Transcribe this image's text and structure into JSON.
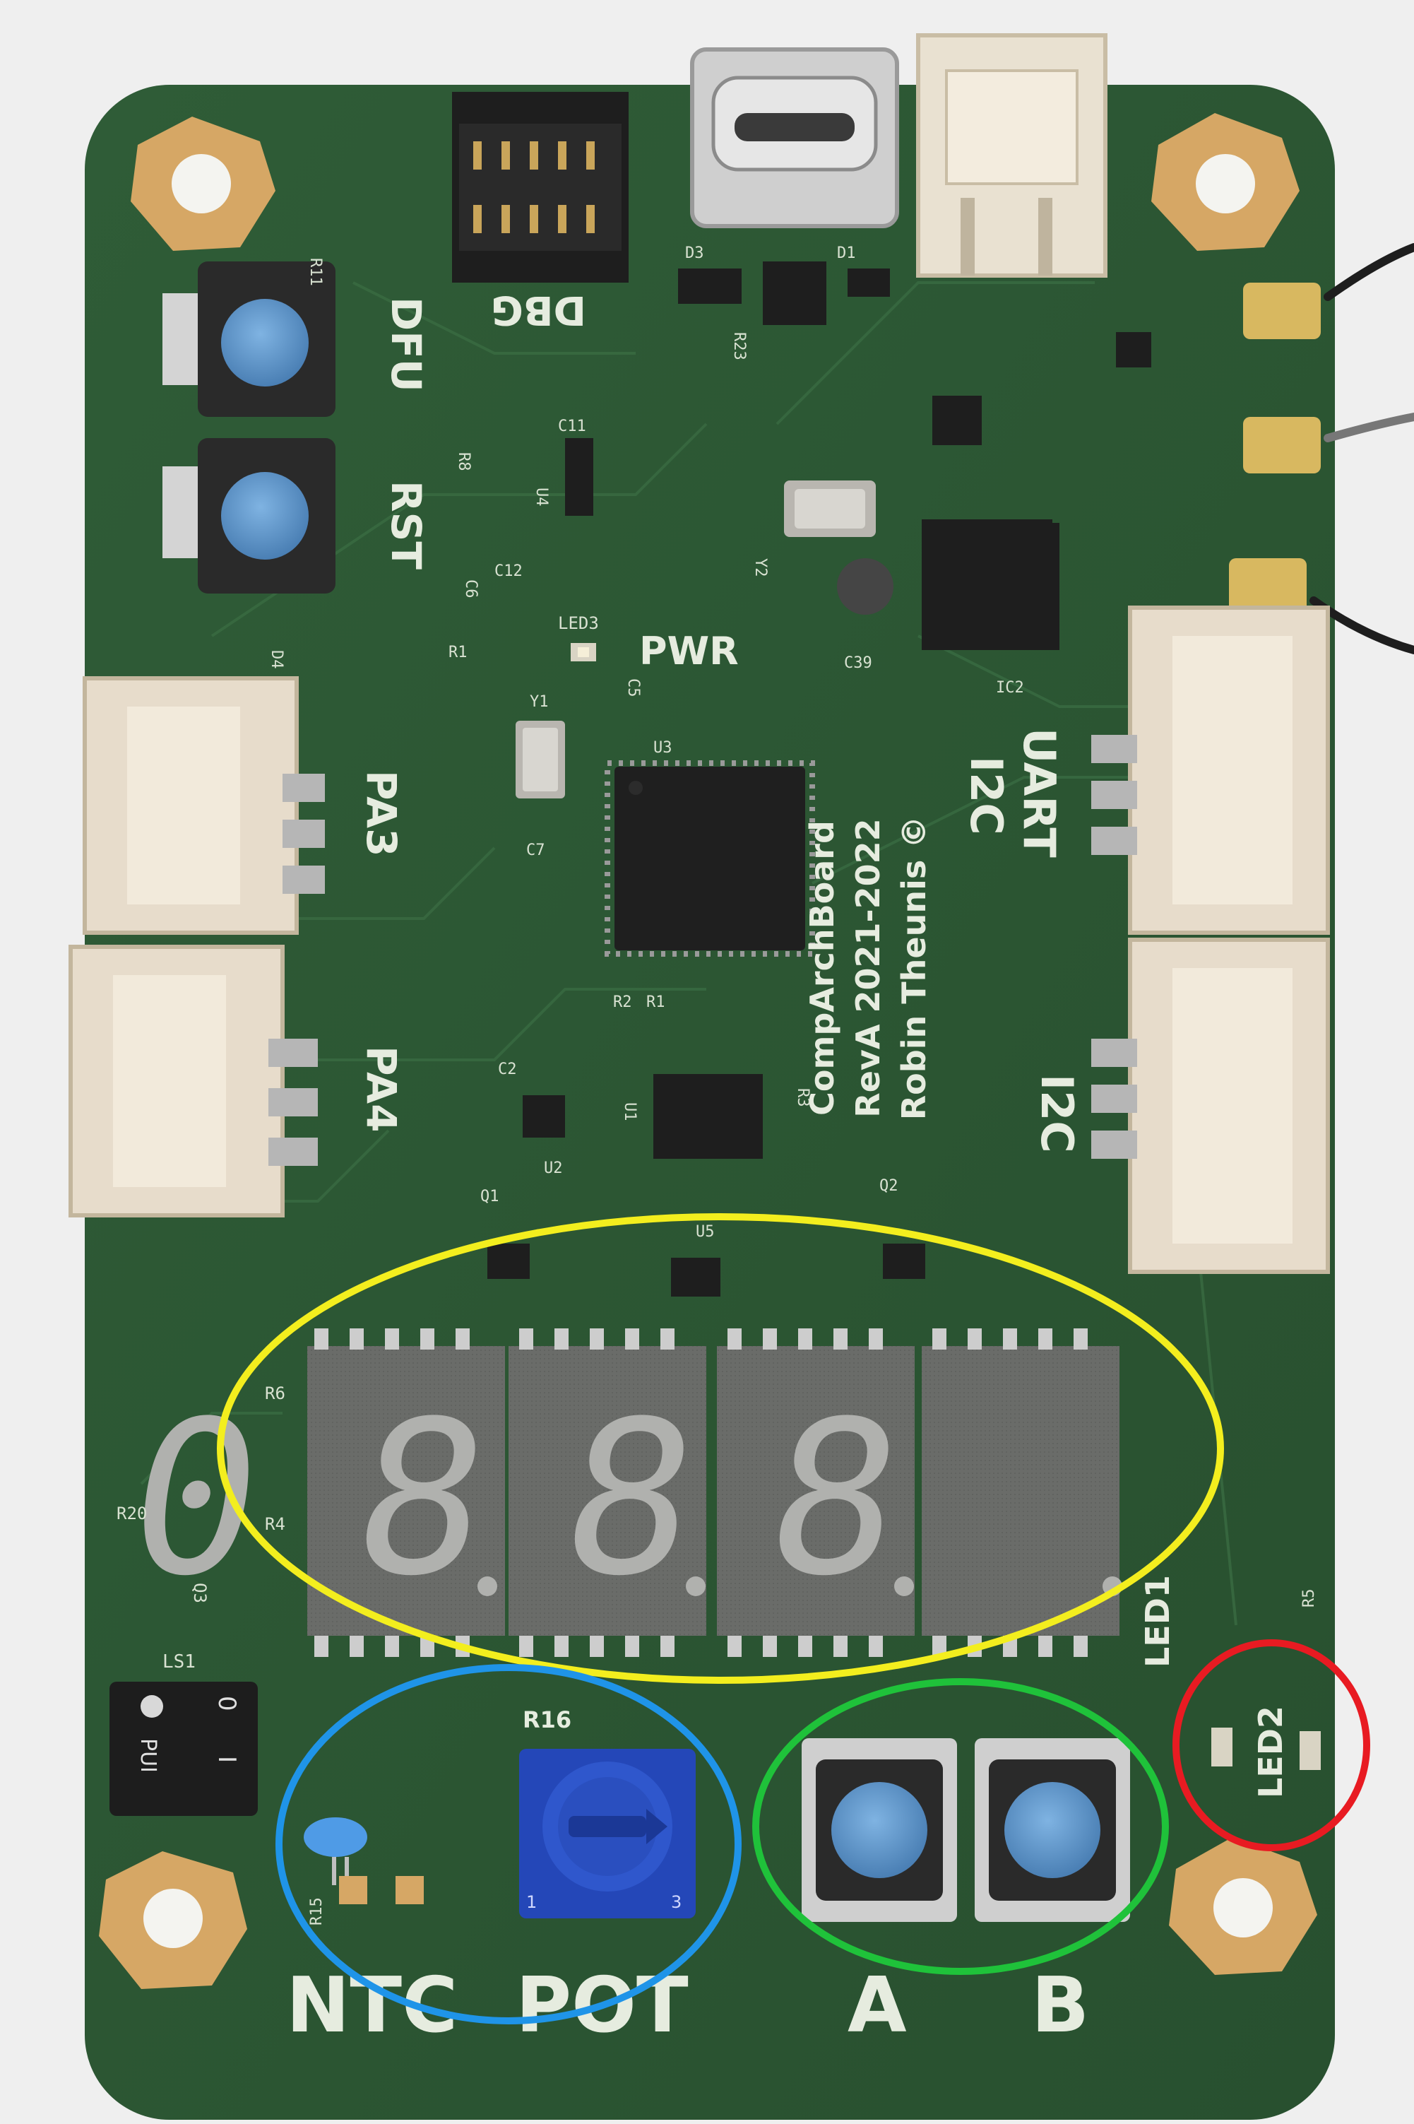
{
  "board": {
    "colors": {
      "pcb": "#2f5a37",
      "pcb_dark": "#23462b",
      "silkscreen": "#e6ecdf",
      "connector": "#e7dccb",
      "button_cap": "#5b94c8",
      "potentiometer": "#2447b8",
      "seven_seg_body": "#6b6d6a",
      "highlight_yellow": "#f3ee1e",
      "highlight_blue": "#1f94e8",
      "highlight_green": "#1fc23a",
      "highlight_red": "#e81b22"
    },
    "labels": {
      "dbg": "DBG",
      "dfu": "DFU",
      "rst": "RST",
      "pwr": "PWR",
      "led3": "LED3",
      "pa3": "PA3",
      "pa4": "PA4",
      "i2c_upper": "I2C",
      "uart": "UART",
      "i2c_lower": "I2C",
      "ntc": "NTC",
      "pot": "POT",
      "button_a": "A",
      "button_b": "B",
      "led1": "LED1",
      "led2": "LED2",
      "buzzer_on": "0",
      "buzzer_off": "I",
      "buzzer_brand": "PUI",
      "board_line1": "CompArchBoard",
      "board_line2": "RevA 2021-2022",
      "board_line3": "Robin Theunis ©",
      "refs": {
        "r11": "R11",
        "r8": "R8",
        "c11": "C11",
        "u4": "U4",
        "c12": "C12",
        "c6": "C6",
        "r1_top": "R1",
        "d3": "D3",
        "d1": "D1",
        "r23": "R23",
        "y2": "Y2",
        "c39": "C39",
        "ic2": "IC2",
        "y1": "Y1",
        "c5": "C5",
        "u3": "U3",
        "c7": "C7",
        "d4": "D4",
        "r2": "R2",
        "r1": "R1",
        "c2": "C2",
        "u2": "U2",
        "u1": "U1",
        "r3": "R3",
        "q1": "Q1",
        "q2": "Q2",
        "u5": "U5",
        "r6": "R6",
        "r4": "R4",
        "r20": "R20",
        "q3": "Q3",
        "ls1": "LS1",
        "r16": "R16",
        "r15": "R15",
        "pot_pin1": "1",
        "pot_pin3": "3",
        "r5": "R5"
      }
    },
    "display_digits": [
      "0",
      "8",
      "8",
      "8"
    ]
  }
}
